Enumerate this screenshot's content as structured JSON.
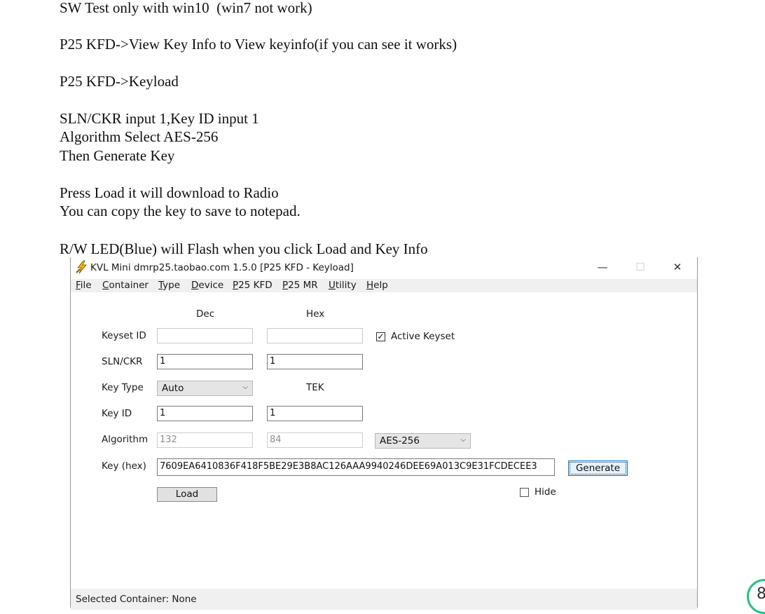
{
  "document": {
    "lines": [
      "SW Test only with win10  (win7 not work)",
      "P25 KFD->View Key Info to View keyinfo(if you can see it works)",
      "P25 KFD->Keyload",
      "SLN/CKR input 1,Key ID input 1",
      "Algorithm Select AES-256",
      "Then Generate Key",
      "Press Load it will download to Radio",
      "You can copy the key to save to notepad.",
      "R/W LED(Blue) will Flash when you click Load and Key Info"
    ]
  },
  "window": {
    "title": "KVL Mini dmrp25.taobao.com 1.5.0 [P25 KFD - Keyload]",
    "controls": {
      "minimize": "—",
      "maximize": "☐",
      "close": "✕"
    },
    "menu": [
      {
        "mnemonic": "F",
        "rest": "ile"
      },
      {
        "mnemonic": "C",
        "rest": "ontainer"
      },
      {
        "mnemonic": "T",
        "rest": "ype"
      },
      {
        "mnemonic": "D",
        "rest": "evice"
      },
      {
        "mnemonic": "P",
        "rest": "25 KFD"
      },
      {
        "mnemonic": "P",
        "rest": "25 MR"
      },
      {
        "mnemonic": "U",
        "rest": "tility"
      },
      {
        "mnemonic": "H",
        "rest": "elp"
      }
    ],
    "app_icon": "lightning-bolt-icon"
  },
  "form": {
    "col_dec": "Dec",
    "col_hex": "Hex",
    "keyset_id": {
      "label": "Keyset ID",
      "dec": "",
      "hex": ""
    },
    "active_keyset": {
      "label": "Active Keyset",
      "checked": true,
      "mark": "✓"
    },
    "sln_ckr": {
      "label": "SLN/CKR",
      "dec": "1",
      "hex": "1"
    },
    "key_type": {
      "label": "Key Type",
      "value": "Auto",
      "tek": "TEK"
    },
    "key_id": {
      "label": "Key ID",
      "dec": "1",
      "hex": "1"
    },
    "algorithm": {
      "label": "Algorithm",
      "dec": "132",
      "hex": "84",
      "value": "AES-256"
    },
    "key_hex": {
      "label": "Key (hex)",
      "value": "7609EA6410836F418F5BE29E3B8AC126AAA9940246DEE69A013C9E31FCDECEE3"
    },
    "generate_label": "Generate",
    "load_label": "Load",
    "hide": {
      "label": "Hide",
      "checked": false
    }
  },
  "status_bar": {
    "text": "Selected Container: None"
  },
  "corner_badge": {
    "text": "8"
  },
  "colors": {
    "focus_border": "#0078d7",
    "menubar_bg": "#f0f0f0",
    "badge_ring": "#26c281"
  }
}
